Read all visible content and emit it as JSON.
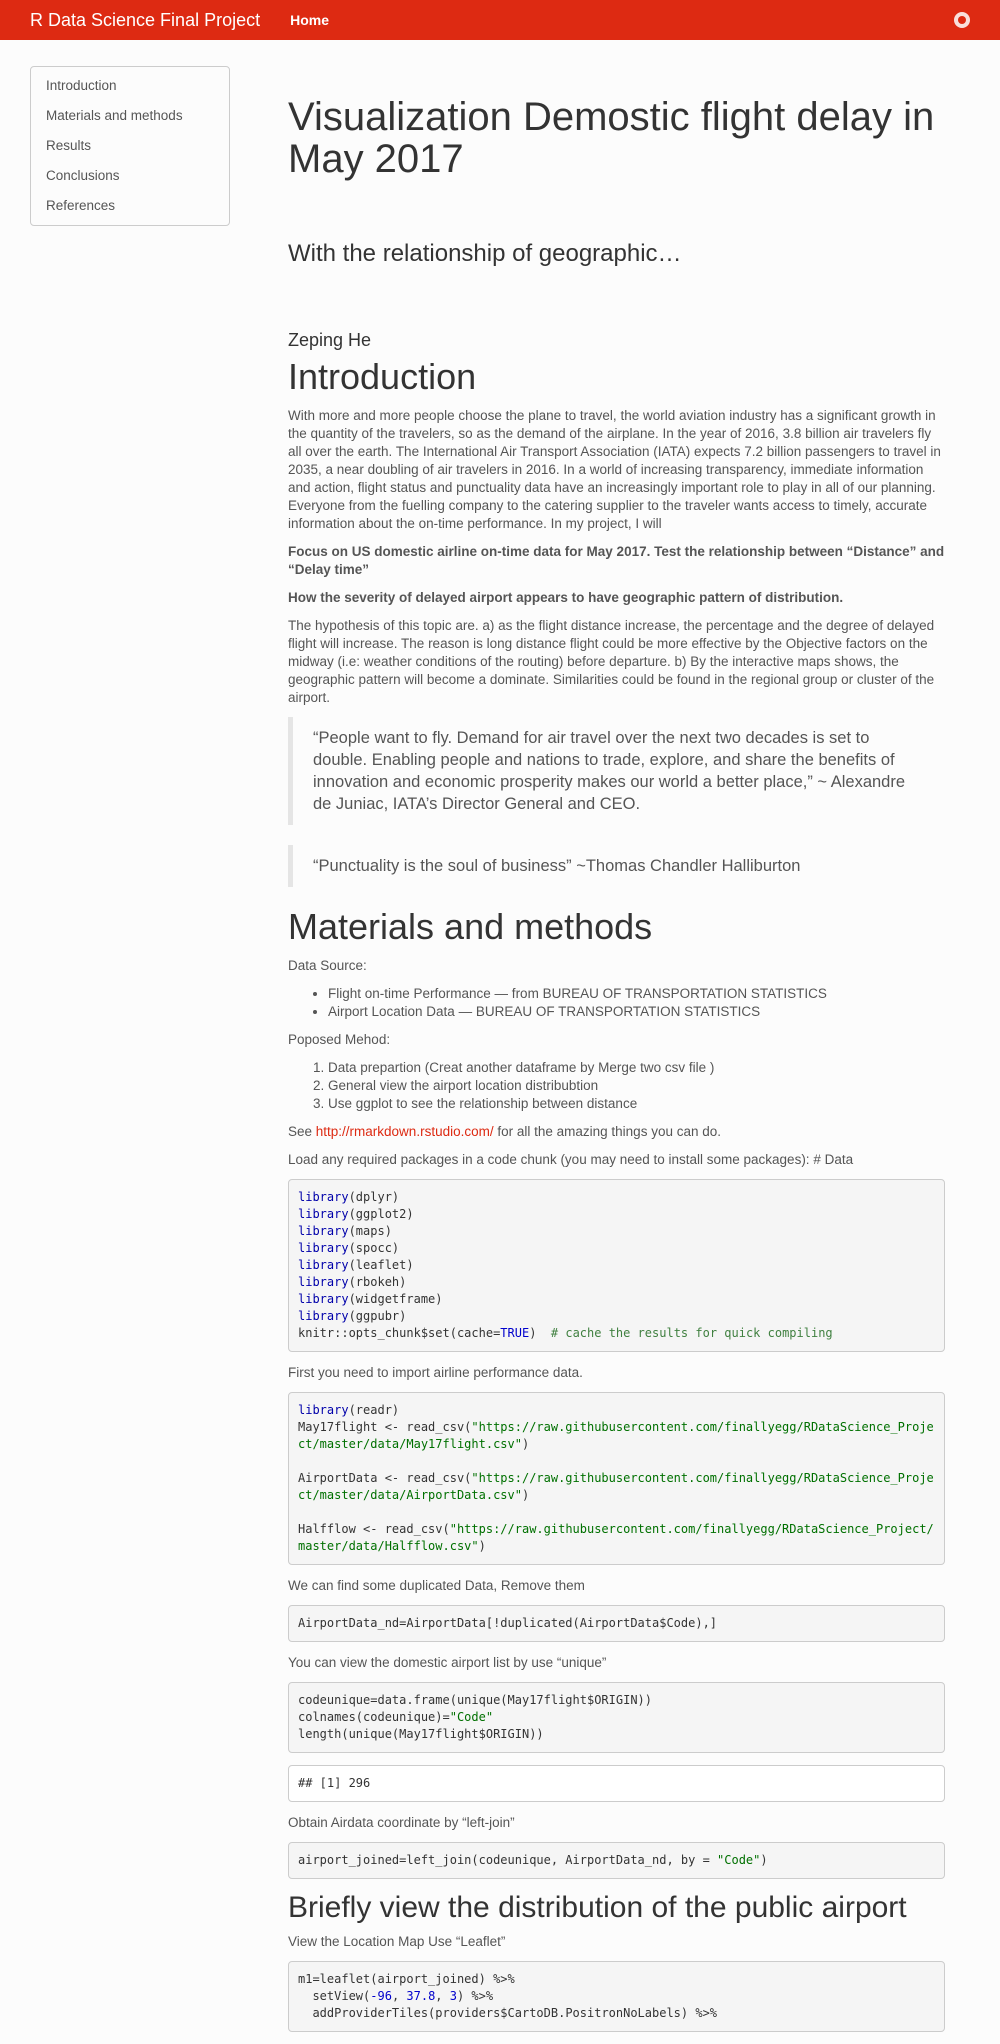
{
  "nav": {
    "brand": "R Data Science Final Project",
    "home": "Home"
  },
  "toc": [
    "Introduction",
    "Materials and methods",
    "Results",
    "Conclusions",
    "References"
  ],
  "header": {
    "title": "Visualization Demostic flight delay in May 2017",
    "subtitle": "With the relationship of geographic…",
    "author": "Zeping He"
  },
  "intro": {
    "heading": "Introduction",
    "p1": "With more and more people choose the plane to travel, the world aviation industry has a significant growth in the quantity of the travelers, so as the demand of the airplane. In the year of 2016, 3.8 billion air travelers fly all over the earth. The International Air Transport Association (IATA) expects 7.2 billion passengers to travel in 2035, a near doubling of air travelers in 2016. In a world of increasing transparency, immediate information and action, flight status and punctuality data have an increasingly important role to play in all of our planning. Everyone from the fuelling company to the catering supplier to the traveler wants access to timely, accurate information about the on-time performance. In my project, I will",
    "bold1": "Focus on US domestic airline on-time data for May 2017. Test the relationship between “Distance” and “Delay time”",
    "bold2": "How the severity of delayed airport appears to have geographic pattern of distribution.",
    "p2": "The hypothesis of this topic are. a) as the flight distance increase, the percentage and the degree of delayed flight will increase. The reason is long distance flight could be more effective by the Objective factors on the midway (i.e: weather conditions of the routing) before departure. b) By the interactive maps shows, the geographic pattern will become a dominate. Similarities could be found in the regional group or cluster of the airport.",
    "quote1": "“People want to fly. Demand for air travel over the next two decades is set to double. Enabling people and nations to trade, explore, and share the benefits of innovation and economic prosperity makes our world a better place,” ~ Alexandre de Juniac, IATA’s Director General and CEO.",
    "quote2": "“Punctuality is the soul of business” ~Thomas Chandler Halliburton"
  },
  "methods": {
    "heading": "Materials and methods",
    "data_source_label": "Data Source:",
    "sources": [
      "Flight on-time Performance — from BUREAU OF TRANSPORTATION STATISTICS",
      "Airport Location Data — BUREAU OF TRANSPORTATION STATISTICS"
    ],
    "method_label": "Poposed Mehod:",
    "steps": [
      "Data prepartion (Creat another dataframe by Merge two csv file )",
      "General view the airport location distribubtion",
      "Use ggplot to see the relationship between distance"
    ],
    "see_prefix": "See ",
    "see_link": "http://rmarkdown.rstudio.com/",
    "see_suffix": " for all the amazing things you can do.",
    "load_text": "Load any required packages in a code chunk (you may need to install some packages): # Data",
    "import_text": "First you need to import airline performance data.",
    "dup_text": "We can find some duplicated Data, Remove them",
    "unique_text": "You can view the domestic airport list by use “unique”",
    "output_text": "## [1] 296",
    "join_text": "Obtain Airdata coordinate by “left-join”"
  },
  "briefly": {
    "heading": "Briefly view the distribution of the public airport",
    "leaflet_text": "View the Location Map Use “Leaflet”"
  },
  "code": {
    "lib_kw": "library",
    "libs": [
      "(dplyr)",
      "(ggplot2)",
      "(maps)",
      "(spocc)",
      "(leaflet)",
      "(rbokeh)",
      "(widgetframe)",
      "(ggpubr)"
    ],
    "knitr_a": "knitr::opts_chunk$set(cache=",
    "knitr_true": "TRUE",
    "knitr_b": ")  ",
    "knitr_comment": "# cache the results for quick compiling",
    "readr": "(readr)",
    "may_a": "May17flight <- read_csv(",
    "may_url": "\"https://raw.githubusercontent.com/finallyegg/RDataScience_Project/master/data/May17flight.csv\"",
    "air_a": "AirportData <- read_csv(",
    "air_url": "\"https://raw.githubusercontent.com/finallyegg/RDataScience_Project/master/data/AirportData.csv\"",
    "half_a": "Halfflow <- read_csv(",
    "half_url": "\"https://raw.githubusercontent.com/finallyegg/RDataScience_Project/master/data/Halfflow.csv\"",
    "close": ")",
    "dup_line": "AirportData_nd=AirportData[!duplicated(AirportData$Code),]",
    "uniq1": "codeunique=data.frame(unique(May17flight$ORIGIN))",
    "uniq2a": "colnames(codeunique)=",
    "uniq2s": "\"Code\"",
    "uniq3": "length(unique(May17flight$ORIGIN))",
    "join_a": "airport_joined=left_join(codeunique, AirportData_nd, by = ",
    "join_s": "\"Code\"",
    "m1": "m1=leaflet(airport_joined) %>%",
    "sv_a": "  setView(",
    "sv_n1": "-96",
    "sv_n2": "37.8",
    "sv_n3": "3",
    "sv_b": ") %>%",
    "sep": ", ",
    "tiles": "  addProviderTiles(providers$CartoDB.PositronNoLabels) %>%"
  }
}
